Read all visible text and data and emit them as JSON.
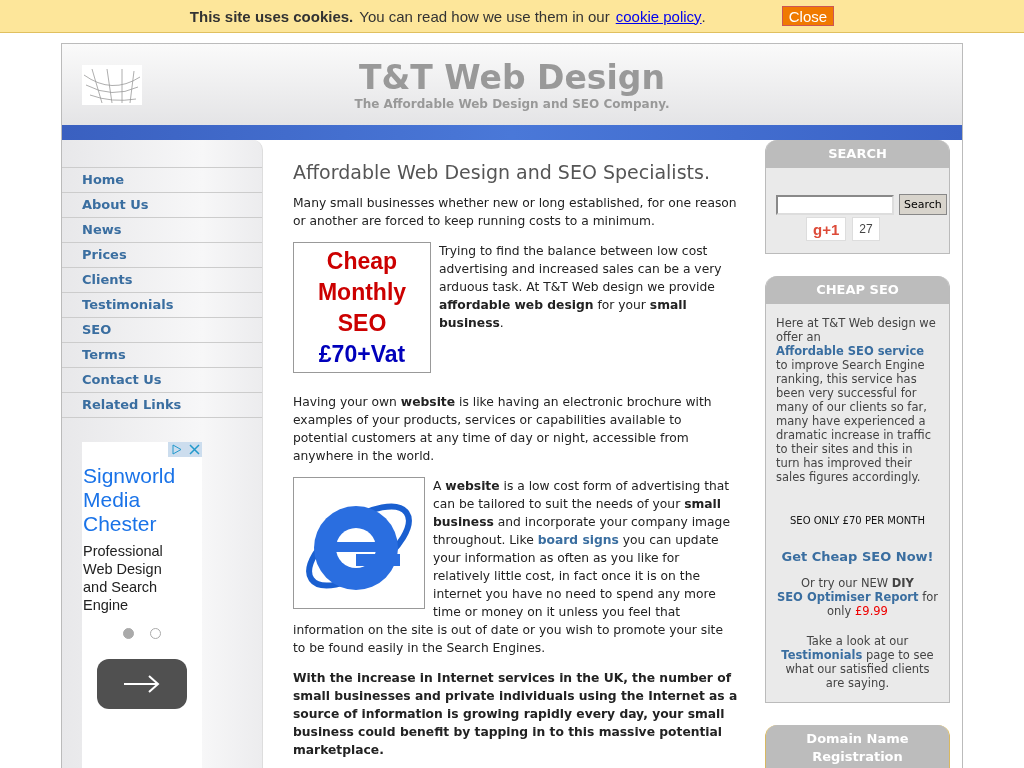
{
  "cookie_bar": {
    "title": "This site uses cookies.",
    "text": "You can read how we use them in our",
    "link": "cookie policy",
    "end": ".",
    "button": "Close"
  },
  "header": {
    "title": "T&T Web Design",
    "tagline": "The Affordable Web Design and SEO Company."
  },
  "nav": [
    {
      "label": "Home"
    },
    {
      "label": "About Us"
    },
    {
      "label": "News"
    },
    {
      "label": "Prices"
    },
    {
      "label": "Clients"
    },
    {
      "label": "Testimonials"
    },
    {
      "label": "SEO"
    },
    {
      "label": "Terms"
    },
    {
      "label": "Contact Us"
    },
    {
      "label": "Related Links"
    }
  ],
  "ad": {
    "title": "Signworld Media Chester",
    "text": "Professional Web Design and Search Engine",
    "pages": [
      {
        "selected": true
      },
      {
        "selected": false
      }
    ]
  },
  "main": {
    "heading": "Affordable Web Design and SEO Specialists.",
    "intro": "Many small businesses whether new or long established, for one reason or another are forced to keep running costs to a minimum.",
    "promo": {
      "lines": [
        {
          "text": "Cheap",
          "color": "#cc0000"
        },
        {
          "text": "Monthly",
          "color": "#cc0000"
        },
        {
          "text": "SEO",
          "color": "#cc0000"
        },
        {
          "text": "£70+Vat",
          "color": "#0000bb"
        }
      ],
      "text": "Trying to find the balance between low cost advertising and increased sales can be a very arduous task. At T&T Web design we provide **affordable web design** for your **small business**."
    },
    "brochure": "Having your own **website** is like having an electronic brochure with examples of your products, services or capabilities available to potential customers at any time of day or night, accessible from anywhere in the world.",
    "website_para": [
      {
        "kind": "plain",
        "text": "A "
      },
      {
        "kind": "bold",
        "text": "website"
      },
      {
        "kind": "plain",
        "text": " is a low cost form of advertising that can be tailored to suit the needs of your "
      },
      {
        "kind": "bold",
        "text": "small business"
      },
      {
        "kind": "plain",
        "text": " and incorporate your company image throughout. Like "
      },
      {
        "kind": "link",
        "text": "board signs"
      },
      {
        "kind": "plain",
        "text": " you can update your information as often as you like for relatively little cost, in fact once it is on the internet you have no need to spend any more time or money on it unless you feel that"
      }
    ],
    "website_para_end": "information on the site is out of date or you wish to promote your site to be found easily in the Search Engines.",
    "closing": "With the increase in Internet services in the UK, the number of small businesses and private individuals using the Internet as a source of information is growing rapidly every day, your small business could benefit by tapping in to this massive potential marketplace."
  },
  "search_box": {
    "title": "SEARCH",
    "button": "Search",
    "plus_one": "g+1",
    "count": "27"
  },
  "seo_box": {
    "title": "CHEAP SEO",
    "text": [
      {
        "kind": "plain",
        "text": "Here at T&T Web design we offer an "
      },
      {
        "kind": "link",
        "text": "Affordable SEO service"
      },
      {
        "kind": "plain",
        "text": " to improve Search Engine ranking, this service has been very successful for many of our clients so far, many have experienced a dramatic increase in traffic to their sites and this in turn has improved their sales figures accordingly."
      }
    ],
    "offer": "SEO ONLY £70 PER MONTH",
    "cta": "Get Cheap SEO Now!",
    "diy": [
      {
        "kind": "plain",
        "text": "Or try our NEW "
      },
      {
        "kind": "bold",
        "text": "DIY "
      },
      {
        "kind": "link",
        "text": "SEO Optimiser Report"
      },
      {
        "kind": "plain",
        "text": " for only "
      },
      {
        "kind": "price",
        "text": "£9.99"
      }
    ],
    "testimonials": [
      {
        "kind": "plain",
        "text": "Take a look at our "
      },
      {
        "kind": "link",
        "text": "Testimonials"
      },
      {
        "kind": "plain",
        "text": " page to see what our satisfied clients are saying."
      }
    ]
  },
  "domain_box": {
    "title": "Domain Name Registration"
  }
}
